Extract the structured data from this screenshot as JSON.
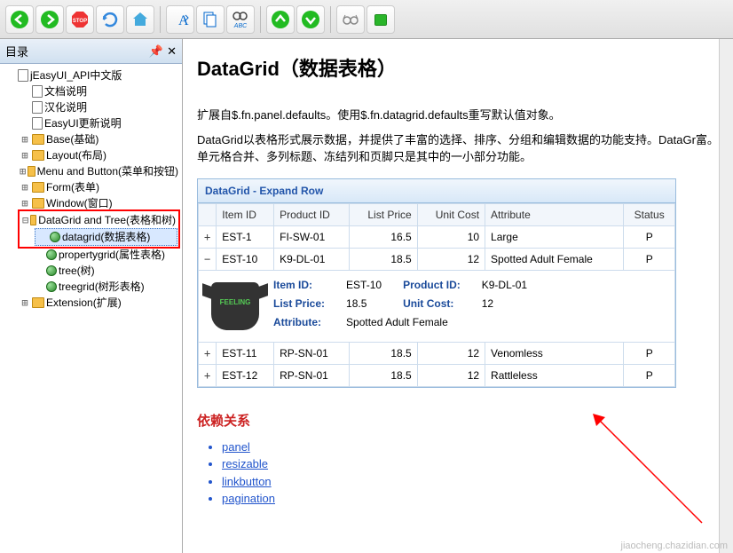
{
  "toolbar_icons": [
    "back",
    "forward",
    "stop",
    "refresh",
    "home",
    "font",
    "copy",
    "find-abc",
    "up",
    "down",
    "glasses",
    "book"
  ],
  "sidebar": {
    "title": "目录",
    "root": "jEasyUI_API中文版",
    "docs": [
      "文档说明",
      "汉化说明",
      "EasyUI更新说明"
    ],
    "folders": [
      "Base(基础)",
      "Layout(布局)",
      "Menu and Button(菜单和按钮)",
      "Form(表单)",
      "Window(窗口)"
    ],
    "datagrid_folder": "DataGrid and Tree(表格和树)",
    "datagrid_children": [
      "datagrid(数据表格)",
      "propertygrid(属性表格)",
      "tree(树)",
      "treegrid(树形表格)"
    ],
    "ext_folder": "Extension(扩展)"
  },
  "content": {
    "h1": "DataGrid（数据表格）",
    "p1": "扩展自$.fn.panel.defaults。使用$.fn.datagrid.defaults重写默认值对象。",
    "p2": "DataGrid以表格形式展示数据，并提供了丰富的选择、排序、分组和编辑数据的功能支持。DataGr富。单元格合并、多列标题、冻结列和页脚只是其中的一小部分功能。",
    "panel_title": "DataGrid - Expand Row",
    "columns": [
      "",
      "Item ID",
      "Product ID",
      "List Price",
      "Unit Cost",
      "Attribute",
      "Status"
    ],
    "rows": [
      {
        "exp": "+",
        "item": "EST-1",
        "prod": "FI-SW-01",
        "price": "16.5",
        "cost": "10",
        "attr": "Large",
        "status": "P"
      },
      {
        "exp": "−",
        "item": "EST-10",
        "prod": "K9-DL-01",
        "price": "18.5",
        "cost": "12",
        "attr": "Spotted Adult Female",
        "status": "P"
      },
      {
        "exp": "+",
        "item": "EST-11",
        "prod": "RP-SN-01",
        "price": "18.5",
        "cost": "12",
        "attr": "Venomless",
        "status": "P"
      },
      {
        "exp": "+",
        "item": "EST-12",
        "prod": "RP-SN-01",
        "price": "18.5",
        "cost": "12",
        "attr": "Rattleless",
        "status": "P"
      }
    ],
    "detail": {
      "shirt_text": "FEELING",
      "labels": {
        "item": "Item ID:",
        "prod": "Product ID:",
        "price": "List Price:",
        "cost": "Unit Cost:",
        "attr": "Attribute:"
      },
      "values": {
        "item": "EST-10",
        "prod": "K9-DL-01",
        "price": "18.5",
        "cost": "12",
        "attr": "Spotted Adult Female"
      }
    },
    "deps_title": "依赖关系",
    "deps": [
      "panel",
      "resizable",
      "linkbutton",
      "pagination"
    ]
  },
  "watermark": "jiaocheng.chazidian.com"
}
